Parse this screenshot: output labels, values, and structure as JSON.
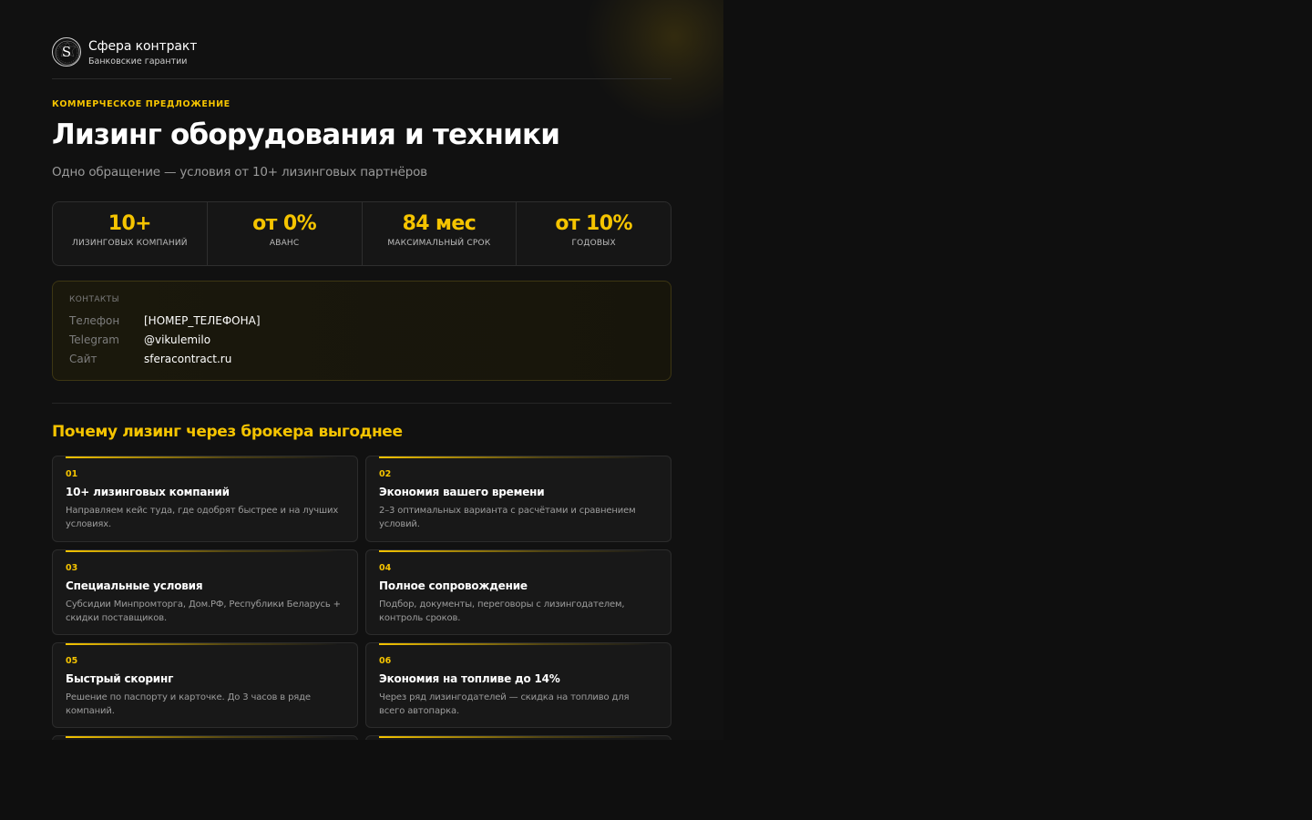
{
  "brand": {
    "logo_letter": "S",
    "name": "Сфера контракт",
    "subtitle": "Банковские гарантии"
  },
  "hero": {
    "eyebrow": "КОММЕРЧЕСКОЕ ПРЕДЛОЖЕНИЕ",
    "title": "Лизинг оборудования и техники",
    "subtitle": "Одно обращение — условия от 10+ лизинговых партнёров"
  },
  "stats": [
    {
      "value": "10+",
      "label": "ЛИЗИНГОВЫХ КОМПАНИЙ"
    },
    {
      "value": "от 0%",
      "label": "АВАНС"
    },
    {
      "value": "84 мес",
      "label": "МАКСИМАЛЬНЫЙ СРОК"
    },
    {
      "value": "от 10%",
      "label": "ГОДОВЫХ"
    }
  ],
  "contacts": {
    "title": "КОНТАКТЫ",
    "rows": [
      {
        "label": "Телефон",
        "value": "[НОМЕР_ТЕЛЕФОНА]"
      },
      {
        "label": "Telegram",
        "value": "@vikulemilo"
      },
      {
        "label": "Сайт",
        "value": "sferacontract.ru"
      }
    ]
  },
  "benefits": {
    "title": "Почему лизинг через брокера выгоднее",
    "items": [
      {
        "num": "01",
        "title": "10+ лизинговых компаний",
        "desc": "Направляем кейс туда, где одобрят быстрее и на лучших условиях."
      },
      {
        "num": "02",
        "title": "Экономия вашего времени",
        "desc": "2–3 оптимальных варианта с расчётами и сравнением условий."
      },
      {
        "num": "03",
        "title": "Специальные условия",
        "desc": "Субсидии Минпромторга, Дом.РФ, Республики Беларусь + скидки поставщиков."
      },
      {
        "num": "04",
        "title": "Полное сопровождение",
        "desc": "Подбор, документы, переговоры с лизингодателем, контроль сроков."
      },
      {
        "num": "05",
        "title": "Быстрый скоринг",
        "desc": "Решение по паспорту и карточке. До 3 часов в ряде компаний."
      },
      {
        "num": "06",
        "title": "Экономия на топливе до 14%",
        "desc": "Через ряд лизингодателей — скидка на топливо для всего автопарка."
      }
    ]
  },
  "colors": {
    "accent": "#f5c400",
    "background": "#111111",
    "card": "#181818"
  }
}
